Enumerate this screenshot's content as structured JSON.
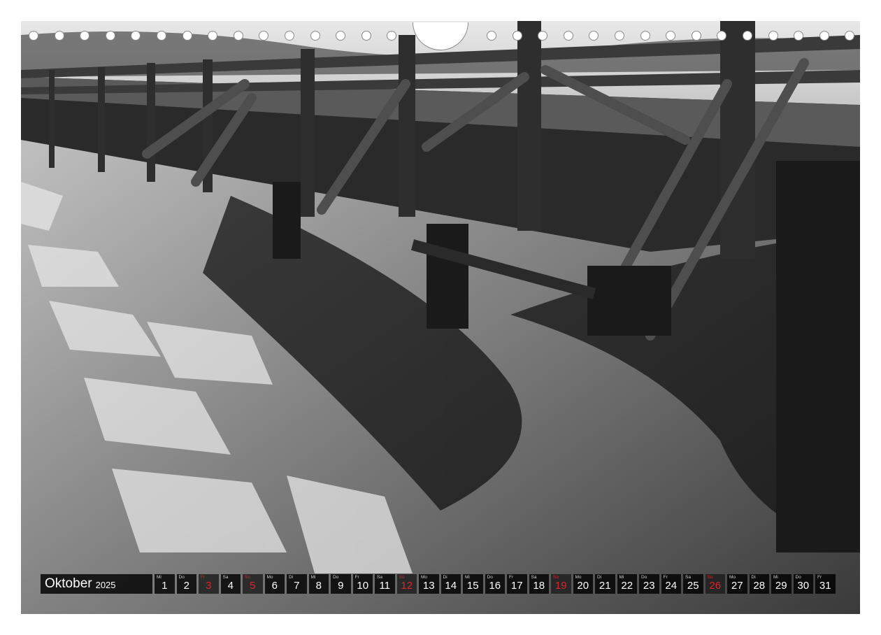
{
  "calendar": {
    "month": "Oktober",
    "year": "2025",
    "accent_color": "#d8262c",
    "days": [
      {
        "wd": "Mi",
        "d": "1"
      },
      {
        "wd": "Do",
        "d": "2"
      },
      {
        "wd": "Fr",
        "d": "3",
        "holiday": true
      },
      {
        "wd": "Sa",
        "d": "4"
      },
      {
        "wd": "So",
        "d": "5",
        "holiday": true
      },
      {
        "wd": "Mo",
        "d": "6"
      },
      {
        "wd": "Di",
        "d": "7"
      },
      {
        "wd": "Mi",
        "d": "8"
      },
      {
        "wd": "Do",
        "d": "9"
      },
      {
        "wd": "Fr",
        "d": "10"
      },
      {
        "wd": "Sa",
        "d": "11"
      },
      {
        "wd": "So",
        "d": "12",
        "holiday": true
      },
      {
        "wd": "Mo",
        "d": "13"
      },
      {
        "wd": "Di",
        "d": "14"
      },
      {
        "wd": "Mi",
        "d": "15"
      },
      {
        "wd": "Do",
        "d": "16"
      },
      {
        "wd": "Fr",
        "d": "17"
      },
      {
        "wd": "Sa",
        "d": "18"
      },
      {
        "wd": "So",
        "d": "19",
        "holiday": true
      },
      {
        "wd": "Mo",
        "d": "20"
      },
      {
        "wd": "Di",
        "d": "21"
      },
      {
        "wd": "Mi",
        "d": "22"
      },
      {
        "wd": "Do",
        "d": "23"
      },
      {
        "wd": "Fr",
        "d": "24"
      },
      {
        "wd": "Sa",
        "d": "25"
      },
      {
        "wd": "So",
        "d": "26",
        "holiday": true
      },
      {
        "wd": "Mo",
        "d": "27"
      },
      {
        "wd": "Di",
        "d": "28"
      },
      {
        "wd": "Mi",
        "d": "29"
      },
      {
        "wd": "Do",
        "d": "30"
      },
      {
        "wd": "Fr",
        "d": "31"
      }
    ]
  }
}
